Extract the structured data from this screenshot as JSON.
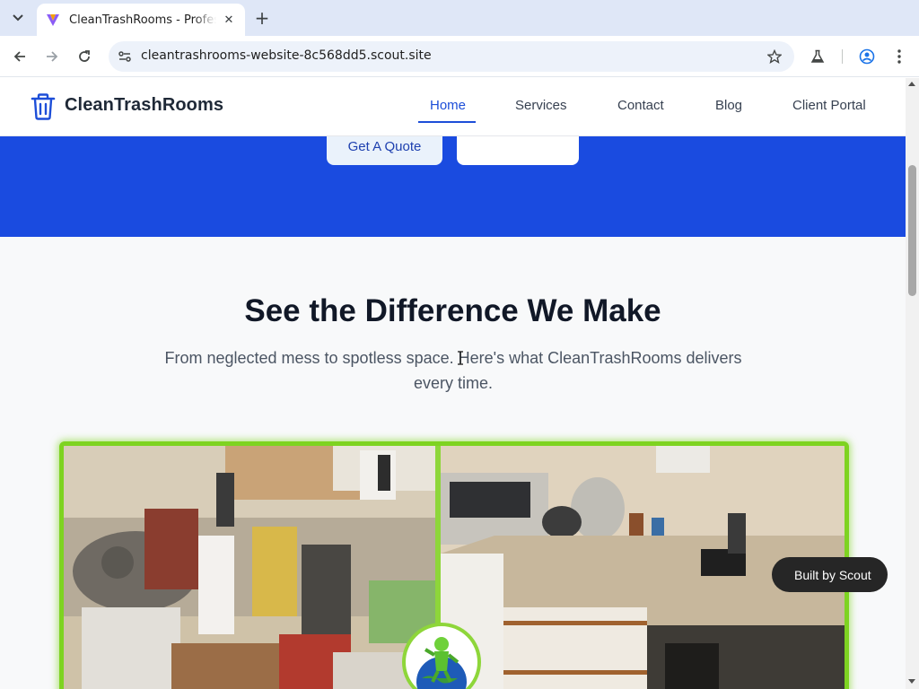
{
  "browser": {
    "tab_title": "CleanTrashRooms - Professional Trash Room Cleaning",
    "url": "cleantrashrooms-website-8c568dd5.scout.site",
    "icons": [
      "tab-list-icon",
      "close-icon",
      "plus-icon",
      "back-icon",
      "forward-icon",
      "reload-icon",
      "site-info-icon",
      "star-icon",
      "labs-icon",
      "profile-icon",
      "kebab-menu-icon"
    ]
  },
  "site": {
    "brand": "CleanTrashRooms",
    "nav": [
      {
        "label": "Home",
        "active": true
      },
      {
        "label": "Services",
        "active": false
      },
      {
        "label": "Contact",
        "active": false
      },
      {
        "label": "Blog",
        "active": false
      },
      {
        "label": "Client Portal",
        "active": false
      }
    ],
    "hero": {
      "quote_button": "Get A Quote",
      "secondary_button": ""
    },
    "section": {
      "title": "See the Difference We Make",
      "subtitle": "From neglected mess to spotless space. Here's what CleanTrashRooms delivers every time."
    },
    "badge": "  Built by Scout"
  },
  "colors": {
    "brand_blue": "#1a4be0",
    "accent_green": "#7ed321",
    "nav_active": "#1d4ed8"
  }
}
